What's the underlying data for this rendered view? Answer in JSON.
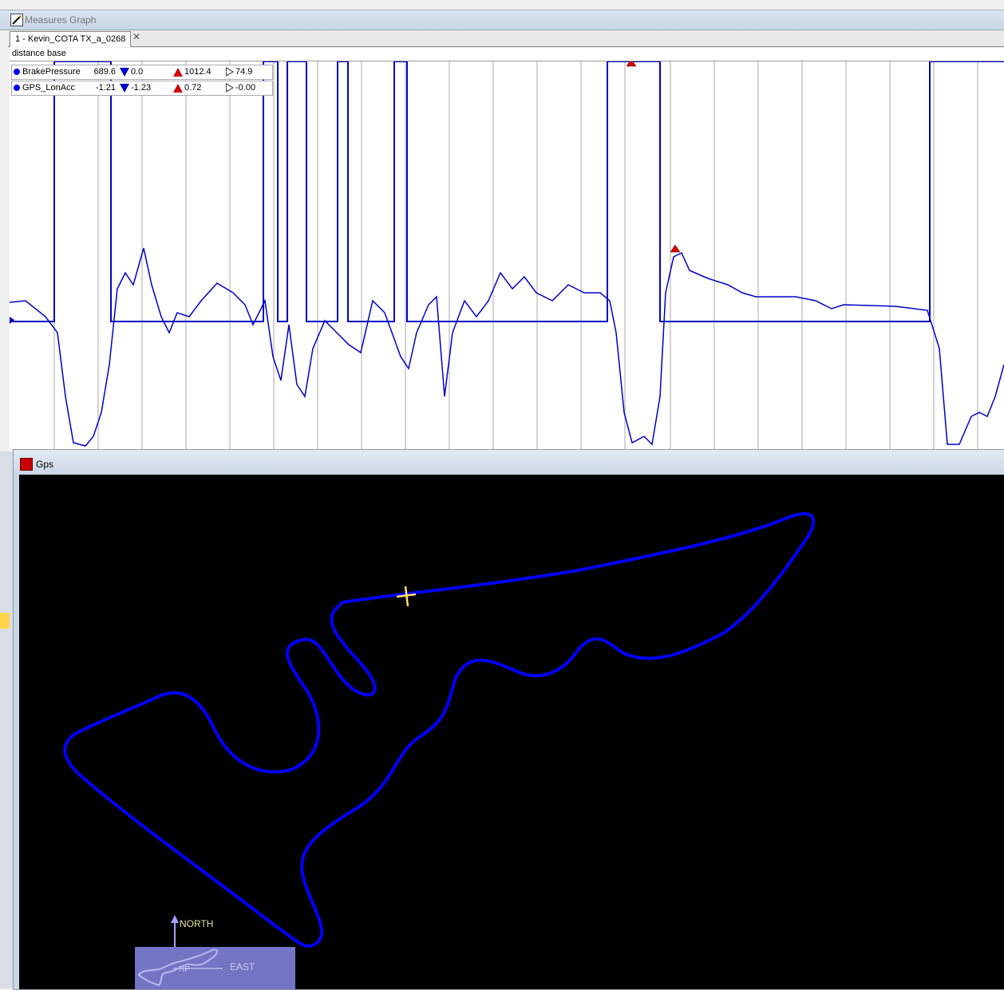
{
  "measures_graph": {
    "title": "Measures Graph",
    "tab_label": "1 - Kevin_COTA TX_a_0268",
    "tab_close": "✕",
    "x_axis_label": "distance base",
    "legend": [
      {
        "name": "BrakePressure",
        "value": "689.6",
        "min": "0.0",
        "max": "1012.4",
        "avg": "74.9",
        "color": "#0000ff"
      },
      {
        "name": "GPS_LonAcc",
        "value": "-1.21",
        "min": "-1.23",
        "max": "0.72",
        "avg": "-0.00",
        "color": "#0000ff"
      }
    ],
    "trace_color": "#0000c8"
  },
  "gps": {
    "title": "Gps",
    "track_color": "#0000ff",
    "cursor_color": "#ffe066",
    "north_label": "NORTH",
    "east_label": "EAST",
    "minimap_color": "#7474c4"
  }
}
